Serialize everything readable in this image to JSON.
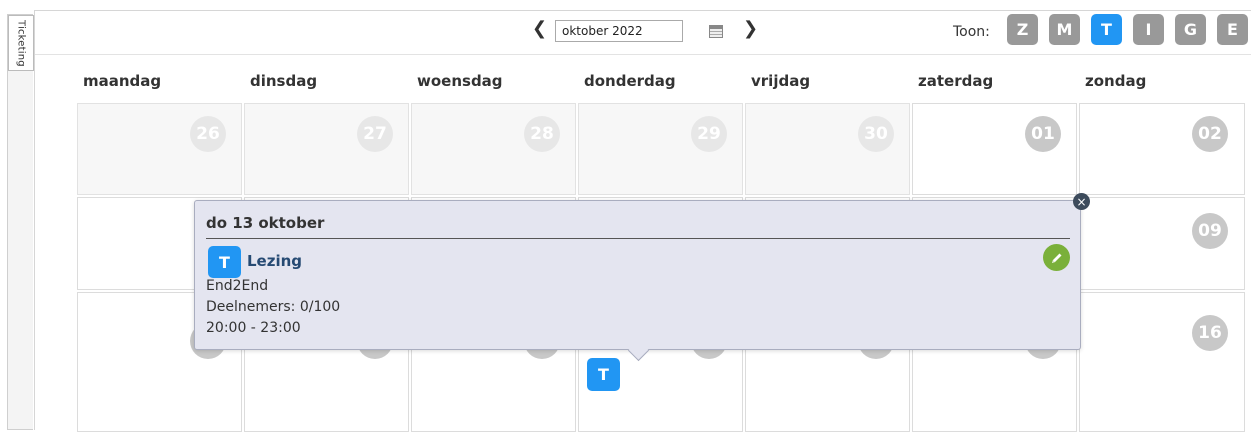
{
  "side_tab": {
    "label": "Ticketing"
  },
  "toolbar": {
    "prev_arrow": "❮",
    "next_arrow": "❯",
    "month_value": "oktober 2022",
    "toon_label": "Toon:",
    "views": [
      {
        "label": "Z",
        "active": false
      },
      {
        "label": "M",
        "active": false
      },
      {
        "label": "T",
        "active": true
      },
      {
        "label": "I",
        "active": false
      },
      {
        "label": "G",
        "active": false
      },
      {
        "label": "E",
        "active": false
      }
    ]
  },
  "weekdays": [
    "maandag",
    "dinsdag",
    "woensdag",
    "donderdag",
    "vrijdag",
    "zaterdag",
    "zondag"
  ],
  "weeks": [
    [
      "26",
      "27",
      "28",
      "29",
      "30",
      "01",
      "02"
    ],
    [
      "",
      "",
      "",
      "",
      "",
      "08",
      "09"
    ],
    [
      "",
      "",
      "",
      "",
      "",
      "15",
      "16"
    ]
  ],
  "event_chip": {
    "label": "T"
  },
  "popover": {
    "date": "do 13 oktober",
    "type_label": "T",
    "title": "Lezing",
    "venue": "End2End",
    "participants": "Deelnemers: 0/100",
    "time": "20:00 - 23:00",
    "close_symbol": "×"
  },
  "colors": {
    "accent": "#2196f3",
    "edit": "#7ab03a",
    "highlight": "#e89a2c"
  }
}
